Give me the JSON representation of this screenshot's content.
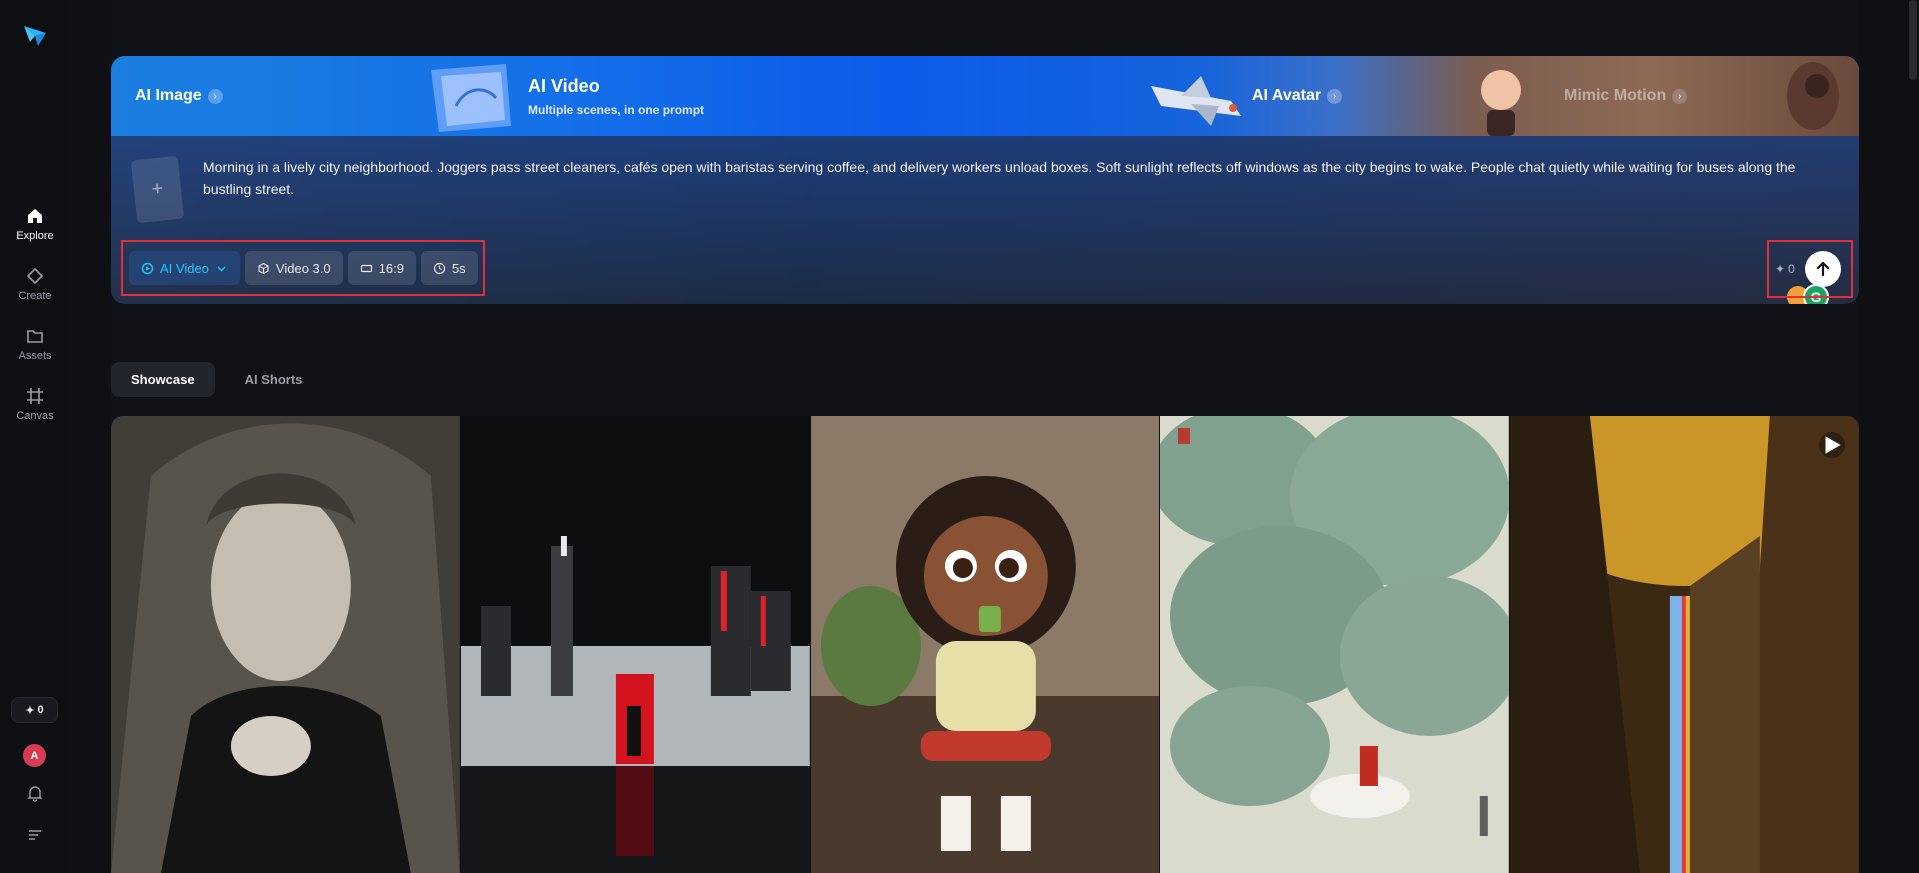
{
  "sidebar": {
    "items": [
      {
        "label": "Explore",
        "icon": "home-icon",
        "active": true
      },
      {
        "label": "Create",
        "icon": "diamond-icon"
      },
      {
        "label": "Assets",
        "icon": "folder-icon"
      },
      {
        "label": "Canvas",
        "icon": "canvas-icon"
      }
    ],
    "credits": "0",
    "avatar_letter": "A"
  },
  "banner": {
    "tabs": {
      "ai_image": "AI Image",
      "ai_video": "AI Video",
      "ai_video_sub": "Multiple scenes, in one prompt",
      "ai_avatar": "AI Avatar",
      "mimic_motion": "Mimic Motion"
    },
    "prompt": "Morning in a lively city neighborhood. Joggers pass street cleaners, cafés open with baristas serving coffee, and delivery workers unload boxes. Soft sunlight reflects off windows as the city begins to wake. People chat quietly while waiting for buses along the bustling street.",
    "controls": {
      "mode": "AI Video",
      "model": "Video 3.0",
      "ratio": "16:9",
      "duration": "5s"
    },
    "cost": "0"
  },
  "sections": {
    "showcase": "Showcase",
    "ai_shorts": "AI Shorts"
  },
  "colors": {
    "accent": "#20c9ff",
    "highlight_border": "#e0303a",
    "background": "#0f1014"
  }
}
